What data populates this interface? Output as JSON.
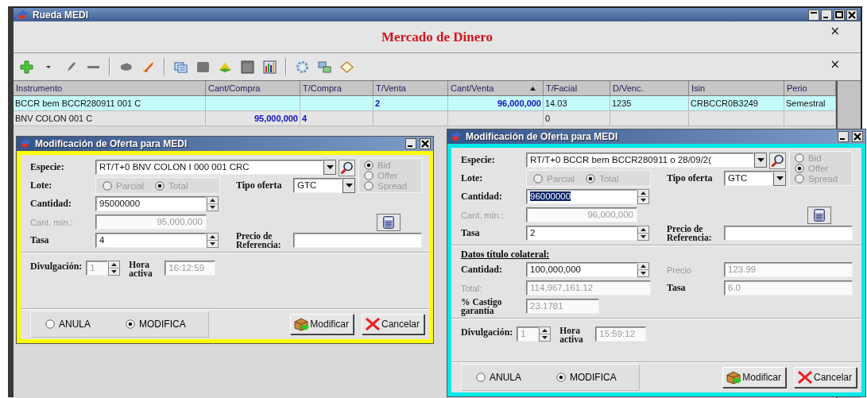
{
  "window": {
    "title": "Rueda MEDI"
  },
  "market": {
    "title": "Mercado de Dinero",
    "close": "×"
  },
  "toolbar": {
    "close": "×"
  },
  "table": {
    "columns": [
      {
        "label": "Instrumento",
        "sorted": false
      },
      {
        "label": "Cant/Compra",
        "sorted": false
      },
      {
        "label": "T/Compra",
        "sorted": false
      },
      {
        "label": "T/Venta",
        "sorted": false
      },
      {
        "label": "Cant/Venta",
        "sorted": true
      },
      {
        "label": "T/Facial",
        "sorted": false
      },
      {
        "label": "D/Venc.",
        "sorted": false
      },
      {
        "label": "Isin",
        "sorted": false
      },
      {
        "label": "Perio",
        "sorted": false
      }
    ],
    "rows": [
      {
        "selected": true,
        "cells": [
          {
            "text": "BCCR bem BCCR280911 001 C",
            "highlighted": false
          },
          null,
          null,
          {
            "text": "2",
            "highlighted": true
          },
          {
            "text": "96,000,000",
            "highlighted": true
          },
          {
            "text": "14.03",
            "highlighted": false
          },
          {
            "text": "1235",
            "highlighted": false
          },
          {
            "text": "CRBCCR0B3249",
            "highlighted": false
          },
          {
            "text": "Semestral",
            "highlighted": false
          }
        ]
      },
      {
        "selected": false,
        "cells": [
          {
            "text": "BNV COLON  001 C",
            "highlighted": false
          },
          {
            "text": "95,000,000",
            "highlighted": true
          },
          {
            "text": "4",
            "highlighted": true
          },
          null,
          null,
          {
            "text": "0",
            "highlighted": false
          },
          null,
          null,
          null
        ]
      }
    ]
  },
  "dialogs": [
    {
      "title": "Modificación de Oferta para MEDI",
      "color": "#ffff00",
      "especie": {
        "label": "Especie:",
        "value": "RT/T+0 BNV COLON  I 000 001 CRC"
      },
      "lote": {
        "label": "Lote:",
        "disabled": true,
        "options": [
          {
            "label": "Parcial",
            "selected": false
          },
          {
            "label": "Total",
            "selected": true
          }
        ]
      },
      "tipo_oferta": {
        "label": "Tipo oferta",
        "value": "GTC"
      },
      "side": {
        "disabled": true,
        "options": [
          {
            "label": "Bid",
            "selected": true
          },
          {
            "label": "Offer",
            "selected": false
          },
          {
            "label": "Spread",
            "selected": false
          }
        ]
      },
      "fields": [
        {
          "kind": "spin",
          "label": "Cantidad:",
          "label_disabled": false,
          "value": "95000000",
          "disabled": false,
          "value_selected": false
        },
        {
          "kind": "number",
          "label": "Cant. mín.:",
          "label_disabled": true,
          "value": "95,000,000",
          "disabled": true,
          "value_selected": false
        },
        {
          "kind": "spin",
          "label": "Tasa",
          "label_disabled": false,
          "value": "4",
          "disabled": false,
          "value_selected": false
        }
      ],
      "referencia": {
        "label": "Precio de Referencia:"
      },
      "divulgacion": {
        "label": "Divulgación:",
        "value": "1"
      },
      "hora_activa": {
        "label": "Hora activa",
        "value": "16:12:59"
      },
      "action": {
        "options": [
          {
            "label": "ANULA",
            "selected": false
          },
          {
            "label": "MODIFICA",
            "selected": true
          }
        ]
      },
      "buttons": [
        {
          "kind": "modify",
          "label": "Modificar"
        },
        {
          "kind": "cancel",
          "label": "Cancelar"
        }
      ]
    },
    {
      "title": "Modificación de Oferta para MEDI",
      "color": "#00e8e8",
      "especie": {
        "label": "Especie:",
        "value": "RT/T+0 BCCR bem BCCR280911 o  28/09/2("
      },
      "lote": {
        "label": "Lote:",
        "disabled": true,
        "options": [
          {
            "label": "Parcial",
            "selected": false
          },
          {
            "label": "Total",
            "selected": true
          }
        ]
      },
      "tipo_oferta": {
        "label": "Tipo oferta",
        "value": "GTC"
      },
      "side": {
        "disabled": true,
        "options": [
          {
            "label": "Bid",
            "selected": false
          },
          {
            "label": "Offer",
            "selected": true
          },
          {
            "label": "Spread",
            "selected": false
          }
        ]
      },
      "fields": [
        {
          "kind": "spin",
          "label": "Cantidad:",
          "label_disabled": false,
          "value": "96000000",
          "disabled": false,
          "value_selected": true
        },
        {
          "kind": "number",
          "label": "Cant. mín.:",
          "label_disabled": true,
          "value": "96,000,000",
          "disabled": true,
          "value_selected": false
        },
        {
          "kind": "spin",
          "label": "Tasa",
          "label_disabled": false,
          "value": "2",
          "disabled": false,
          "value_selected": false
        }
      ],
      "referencia": {
        "label": "Precio de Referencia:"
      },
      "collateral": {
        "heading": "Datos título colateral:",
        "rows": [
          [
            {
              "kind": "spin",
              "label": "Cantidad:",
              "label_disabled": false,
              "value": "100,000,000",
              "disabled": false,
              "value_selected": false
            },
            {
              "kind": "text",
              "label": "Precio",
              "label_disabled": true,
              "value": "123.99",
              "disabled": true,
              "value_selected": false
            }
          ],
          [
            {
              "kind": "text",
              "label": "Total:",
              "label_disabled": true,
              "value": "114,967,161.12",
              "disabled": true,
              "value_selected": false
            },
            {
              "kind": "text",
              "label": "Tasa",
              "label_disabled": false,
              "value": "6.0",
              "disabled": true,
              "value_selected": false
            }
          ],
          [
            {
              "kind": "short",
              "label": "% Castigo garantía",
              "label_disabled": false,
              "value": "23.1781",
              "disabled": true,
              "value_selected": false
            }
          ]
        ]
      },
      "divulgacion": {
        "label": "Divulgación:",
        "value": "1"
      },
      "hora_activa": {
        "label": "Hora activa",
        "value": "15:59:12"
      },
      "action": {
        "options": [
          {
            "label": "ANULA",
            "selected": false
          },
          {
            "label": "MODIFICA",
            "selected": true
          }
        ]
      },
      "buttons": [
        {
          "kind": "modify",
          "label": "Modificar"
        },
        {
          "kind": "cancel",
          "label": "Cancelar"
        }
      ]
    }
  ]
}
